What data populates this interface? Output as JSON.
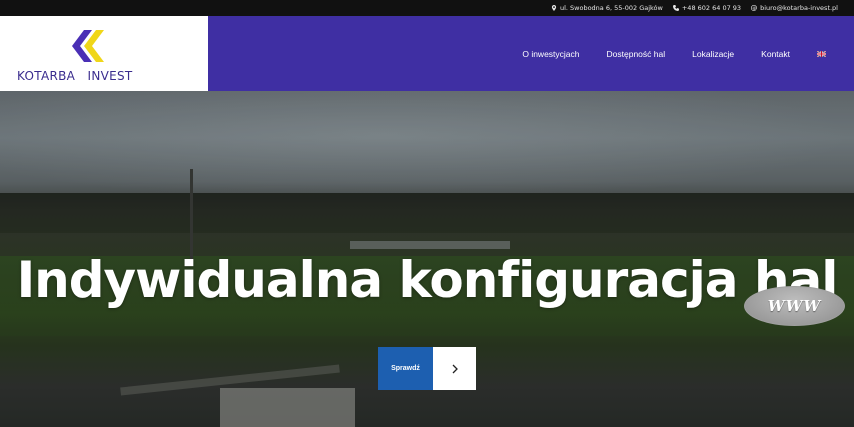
{
  "topbar": {
    "address": "ul. Swobodna 6, 55-002 Gajków",
    "phone": "+48 602 64 07 93",
    "email": "biuro@kotarba-invest.pl"
  },
  "logo": {
    "text": "KOTARBA   INVEST",
    "colors": {
      "purple": "#4a2fb5",
      "yellow": "#f0d619"
    }
  },
  "nav": {
    "items": [
      {
        "label": "O inwestycjach"
      },
      {
        "label": "Dostępność hal"
      },
      {
        "label": "Lokalizacje"
      },
      {
        "label": "Kontakt"
      }
    ],
    "language_flag": "uk-flag-icon"
  },
  "hero": {
    "title": "Indywidualna konfiguracja hal",
    "cta_label": "Sprawdź",
    "cta_icon": "chevron-right-icon"
  },
  "badge": {
    "text": "WWW"
  },
  "colors": {
    "header_bg": "#3f2fa3",
    "topbar_bg": "#111111",
    "cta_bg": "#1d5fb0"
  }
}
